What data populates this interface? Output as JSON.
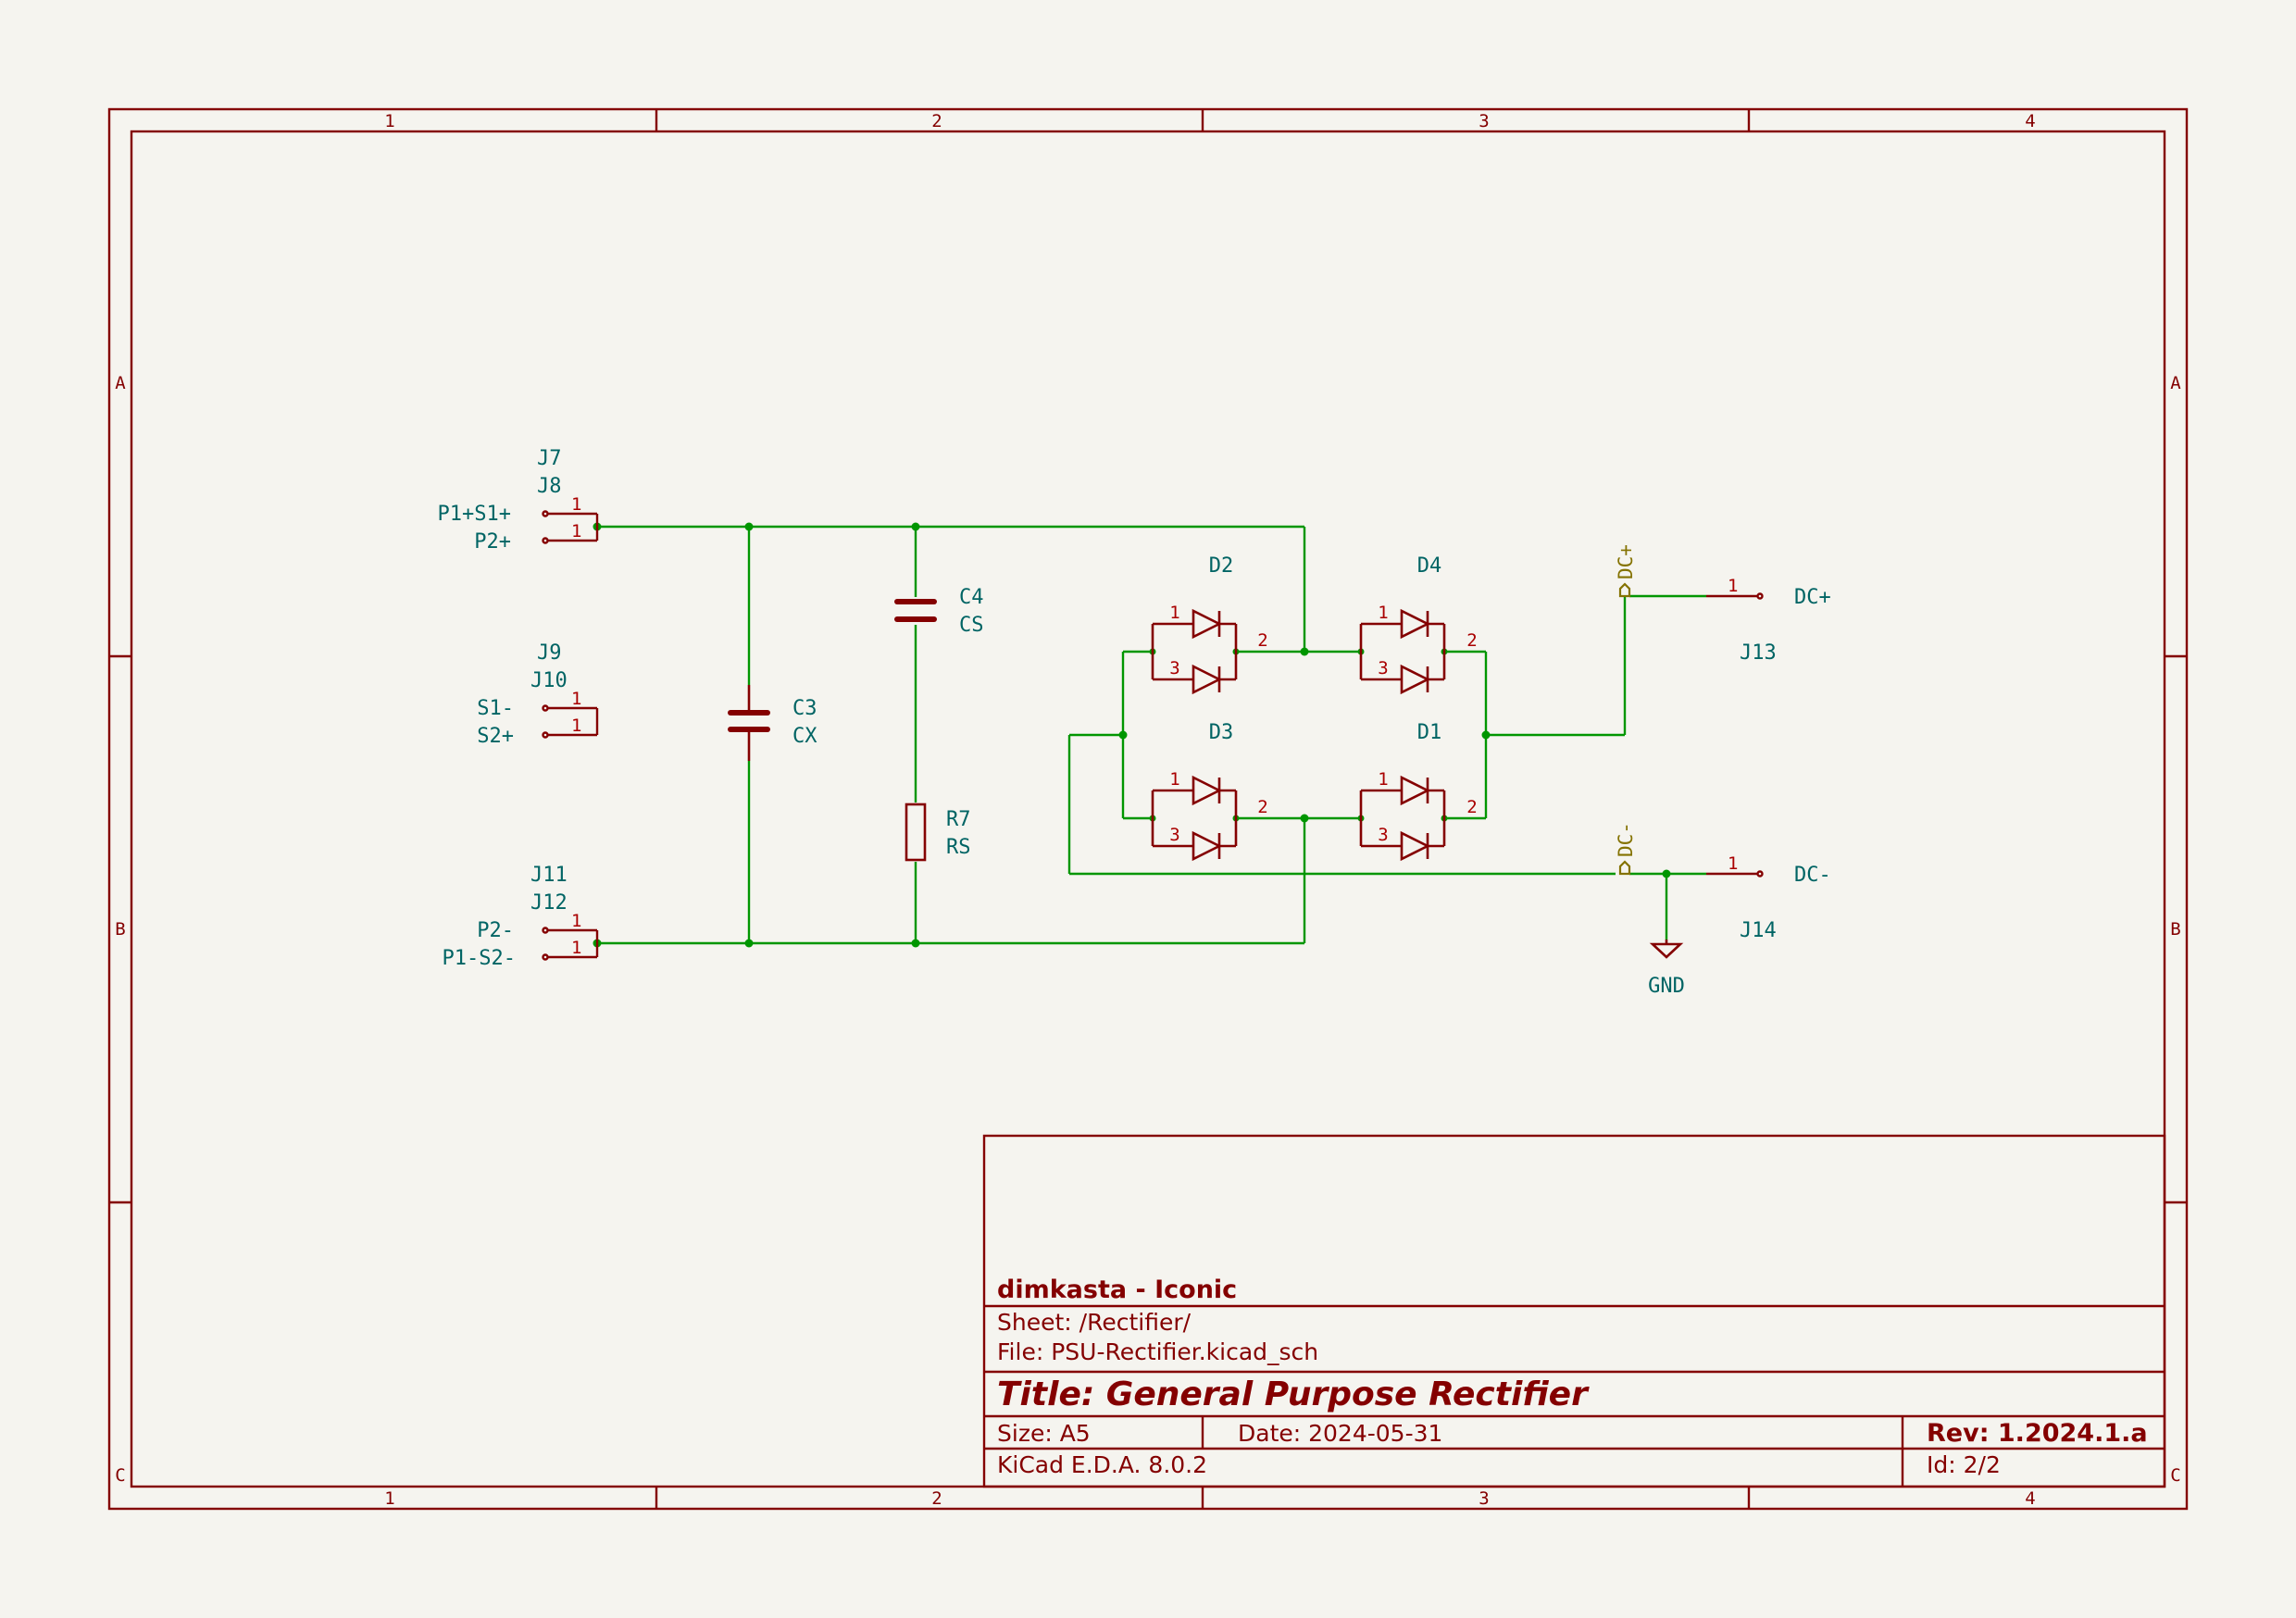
{
  "frame": {
    "columns": [
      "1",
      "2",
      "3",
      "4"
    ],
    "rows": [
      "A",
      "B",
      "C"
    ]
  },
  "title_block": {
    "company": "dimkasta - Iconic",
    "sheet": "Sheet: /Rectifier/",
    "file": "File: PSU-Rectifier.kicad_sch",
    "title": "Title: General Purpose Rectifier",
    "size": "Size: A5",
    "date": "Date: 2024-05-31",
    "rev": "Rev: 1.2024.1.a",
    "tool": "KiCad E.D.A. 8.0.2",
    "id": "Id: 2/2"
  },
  "connectors": {
    "J7": {
      "ref": "J7",
      "label": "P1+S1+",
      "pin": "1"
    },
    "J8": {
      "ref": "J8",
      "label": "P2+",
      "pin": "1"
    },
    "J9": {
      "ref": "J9",
      "label": "S1-",
      "pin": "1"
    },
    "J10": {
      "ref": "J10",
      "label": "S2+",
      "pin": "1"
    },
    "J11": {
      "ref": "J11",
      "label": "P2-",
      "pin": "1"
    },
    "J12": {
      "ref": "J12",
      "label": "P1-S2-",
      "pin": "1"
    },
    "J13": {
      "ref": "J13",
      "label": "DC+",
      "pin": "1"
    },
    "J14": {
      "ref": "J14",
      "label": "DC-",
      "pin": "1"
    }
  },
  "components": {
    "C3": {
      "ref": "C3",
      "value": "CX"
    },
    "C4": {
      "ref": "C4",
      "value": "CS"
    },
    "R7": {
      "ref": "R7",
      "value": "RS"
    }
  },
  "diodes": {
    "D2": {
      "ref": "D2",
      "pins": [
        "1",
        "3",
        "2"
      ]
    },
    "D4": {
      "ref": "D4",
      "pins": [
        "1",
        "3",
        "2"
      ]
    },
    "D3": {
      "ref": "D3",
      "pins": [
        "1",
        "3",
        "2"
      ]
    },
    "D1": {
      "ref": "D1",
      "pins": [
        "1",
        "3",
        "2"
      ]
    }
  },
  "ports": {
    "dc_plus": "DC+",
    "dc_minus": "DC-"
  },
  "power": {
    "gnd": "GND"
  },
  "colors": {
    "background": "#f5f4ef",
    "frame": "#840000",
    "wire": "#009600",
    "label": "#006464",
    "port": "#847200"
  }
}
